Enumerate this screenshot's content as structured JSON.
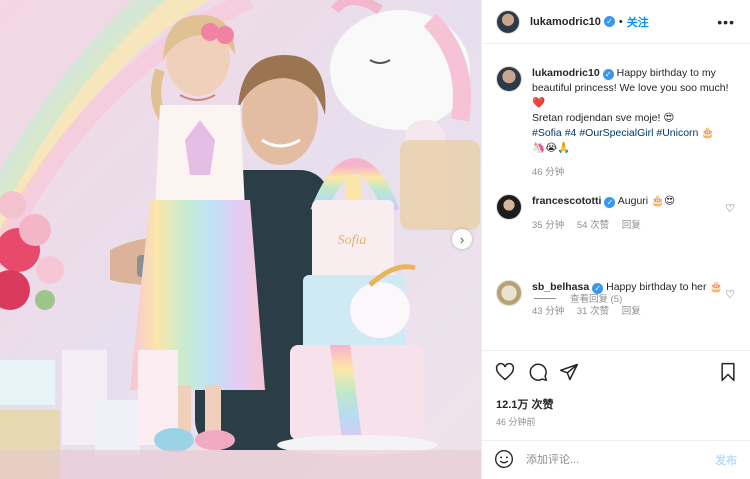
{
  "post": {
    "username": "lukamodric10",
    "follow_label": "关注",
    "more_label": "•••"
  },
  "caption": {
    "username": "lukamodric10",
    "text_1": "Happy birthday to my beautiful princess! We love you soo much! ",
    "heart": "❤️",
    "text_2": "Sretan rodjendan sve moje! ",
    "emoji_1": "😍",
    "hashtags": [
      "#Sofia",
      "#4",
      "#OurSpecialGirl",
      "#Unicorn"
    ],
    "emoji_2": "🎂",
    "emoji_3": "🦄😭🙏",
    "time": "46 分钟"
  },
  "comments": [
    {
      "username": "francescototti",
      "text": "Auguri ",
      "emojis": "🎂😍",
      "time": "35 分钟",
      "likes": "54 次赞",
      "reply": "回复"
    },
    {
      "username": "sb_belhasa",
      "text": "Happy birthday to her ",
      "emojis": "🎂",
      "time": "43 分钟",
      "likes": "31 次赞",
      "reply": "回复"
    }
  ],
  "view_replies": "查看回复 (5)",
  "likes": "12.1万 次赞",
  "posted_time": "46 分钟前",
  "composer": {
    "placeholder": "添加评论...",
    "post_label": "发布"
  },
  "photo": {
    "cake_name": "Sofia"
  },
  "icons": {
    "heart": "heart-icon",
    "comment": "comment-icon",
    "share": "share-icon",
    "save": "bookmark-icon",
    "emoji": "emoji-icon",
    "next": "chevron-right-icon"
  },
  "colors": {
    "accent": "#0095f6",
    "verified": "#3897f0",
    "hashtag": "#00376b"
  }
}
